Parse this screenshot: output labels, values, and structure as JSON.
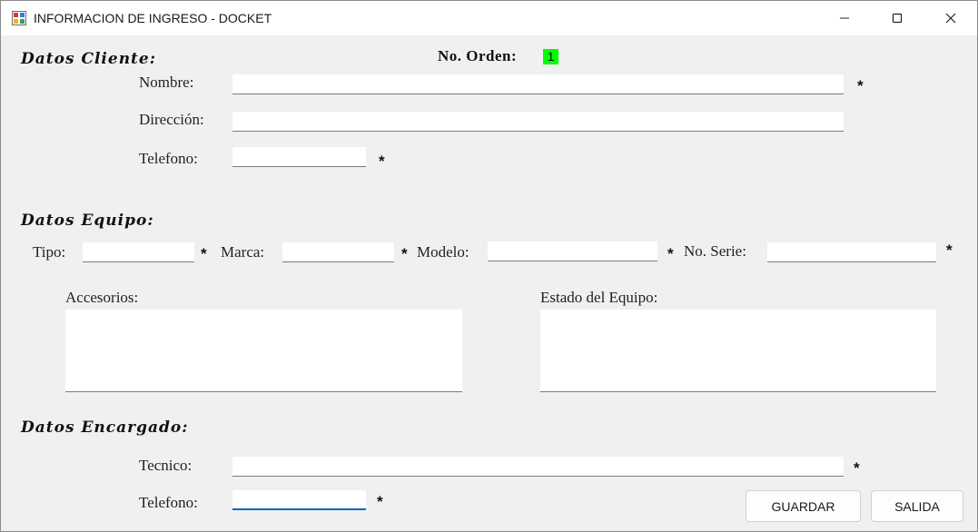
{
  "window": {
    "title": "INFORMACION DE INGRESO - DOCKET",
    "app_icon": "windows-form-icon",
    "controls": {
      "minimize": "minimize-icon",
      "maximize": "maximize-icon",
      "close": "close-icon"
    }
  },
  "cliente": {
    "section_title": "Datos Cliente:",
    "orden_label": "No. Orden:",
    "orden_value": "1",
    "nombre_label": "Nombre:",
    "nombre_value": "",
    "direccion_label": "Dirección:",
    "direccion_value": "",
    "telefono_label": "Telefono:",
    "telefono_value": ""
  },
  "equipo": {
    "section_title": "Datos Equipo:",
    "tipo_label": "Tipo:",
    "tipo_value": "",
    "marca_label": "Marca:",
    "marca_value": "",
    "modelo_label": "Modelo:",
    "modelo_value": "",
    "serie_label": "No. Serie:",
    "serie_value": "",
    "accesorios_label": "Accesorios:",
    "accesorios_value": "",
    "estado_label": "Estado del Equipo:",
    "estado_value": ""
  },
  "encargado": {
    "section_title": "Datos Encargado:",
    "tecnico_label": "Tecnico:",
    "tecnico_value": "",
    "telefono_label": "Telefono:",
    "telefono_value": ""
  },
  "required_marker": "*",
  "buttons": {
    "guardar": "GUARDAR",
    "salida": "SALIDA"
  },
  "colors": {
    "orden_highlight": "#00ff00",
    "focus_accent": "#0067c0",
    "background": "#f0f0f0"
  }
}
